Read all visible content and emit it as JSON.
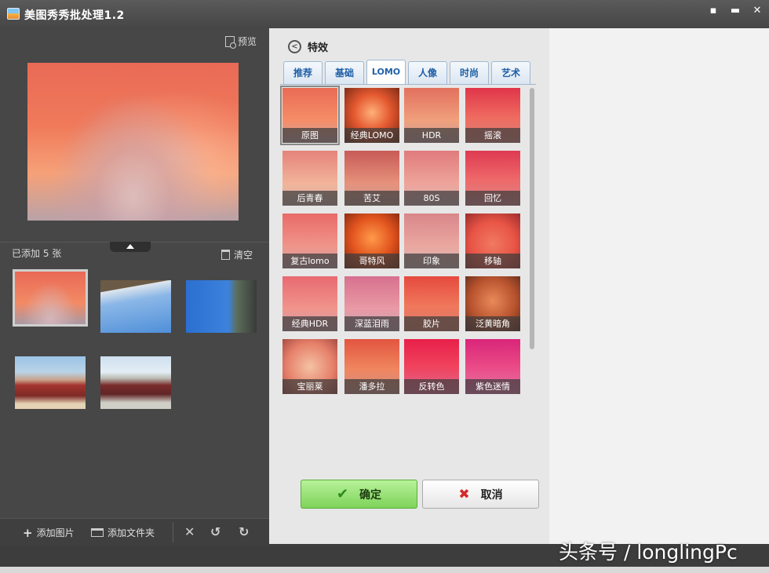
{
  "window": {
    "title": "美图秀秀批处理1.2",
    "controls": [
      "chat-icon",
      "minimize-icon",
      "close-icon"
    ]
  },
  "left": {
    "preview_label": "预览",
    "added_count": "已添加 5 张",
    "clear_label": "清空",
    "thumbnails": [
      "sunset-sky",
      "bridge",
      "blue-sky",
      "group-photo-1",
      "group-photo-2"
    ],
    "selected_thumbnail": 0,
    "add_image_label": "添加图片",
    "add_folder_label": "添加文件夹"
  },
  "effects": {
    "header": "特效",
    "tabs": [
      "推荐",
      "基础",
      "LOMO",
      "人像",
      "时尚",
      "艺术"
    ],
    "active_tab": "LOMO",
    "items": [
      "原图",
      "经典LOMO",
      "HDR",
      "摇滚",
      "后青春",
      "苦艾",
      "80S",
      "回忆",
      "复古lomo",
      "哥特风",
      "印象",
      "移轴",
      "经典HDR",
      "深蓝泪雨",
      "胶片",
      "泛黄暗角",
      "宝丽莱",
      "潘多拉",
      "反转色",
      "紫色迷情"
    ],
    "selected_item": "原图",
    "ok_label": "确定",
    "cancel_label": "取消"
  },
  "watermark": "头条号 / longlingPc"
}
